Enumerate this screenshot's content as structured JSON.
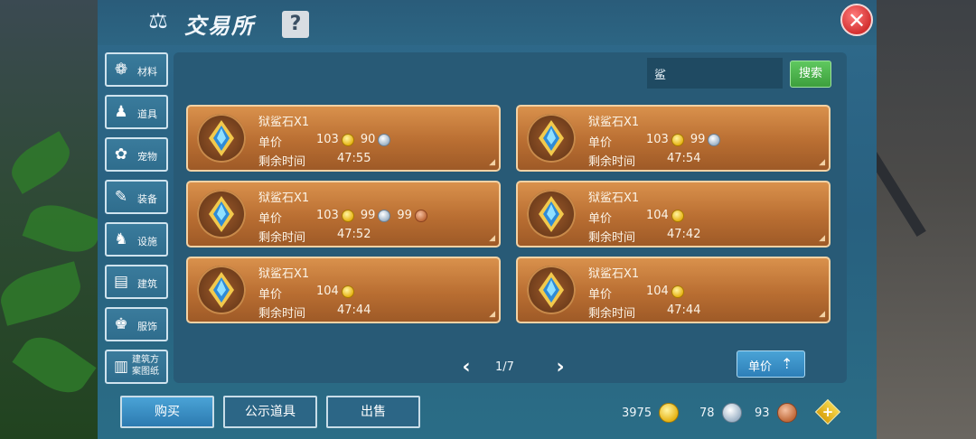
{
  "window": {
    "title": "交易所",
    "help_label": "?",
    "close_label": "✕"
  },
  "sidebar": {
    "items": [
      {
        "label": "材料",
        "icon": "materials-icon",
        "glyph": "❁"
      },
      {
        "label": "道具",
        "icon": "props-icon",
        "glyph": "♟"
      },
      {
        "label": "宠物",
        "icon": "paw-icon",
        "glyph": "✿"
      },
      {
        "label": "装备",
        "icon": "equipment-icon",
        "glyph": "✎"
      },
      {
        "label": "设施",
        "icon": "facility-icon",
        "glyph": "♞"
      },
      {
        "label": "建筑",
        "icon": "building-icon",
        "glyph": "▤"
      },
      {
        "label": "服饰",
        "icon": "clothing-icon",
        "glyph": "♚"
      },
      {
        "label": "建筑方案图纸",
        "icon": "blueprint-icon",
        "glyph": "▥"
      }
    ]
  },
  "search": {
    "value": "鲨",
    "button_label": "搜索"
  },
  "listing_labels": {
    "price": "单价",
    "time": "剩余时间"
  },
  "listings": [
    {
      "name": "狱鲨石X1",
      "gold": "103",
      "silver": "90",
      "time": "47:55"
    },
    {
      "name": "狱鲨石X1",
      "gold": "103",
      "silver": "99",
      "time": "47:54"
    },
    {
      "name": "狱鲨石X1",
      "gold": "103",
      "silver": "99",
      "copper": "99",
      "time": "47:52"
    },
    {
      "name": "狱鲨石X1",
      "gold": "104",
      "time": "47:42"
    },
    {
      "name": "狱鲨石X1",
      "gold": "104",
      "time": "47:44"
    },
    {
      "name": "狱鲨石X1",
      "gold": "104",
      "time": "47:44"
    }
  ],
  "pager": {
    "text": "1/7",
    "current": 1,
    "total": 7
  },
  "sort": {
    "label": "单价"
  },
  "tabs": {
    "buy": "购买",
    "public": "公示道具",
    "sell": "出售"
  },
  "currency": {
    "gold": "3975",
    "silver": "78",
    "copper": "93"
  },
  "colors": {
    "panel": "#285a76",
    "card": "#c07a3a",
    "accent_green": "#4cb54c",
    "close": "#d33030"
  }
}
